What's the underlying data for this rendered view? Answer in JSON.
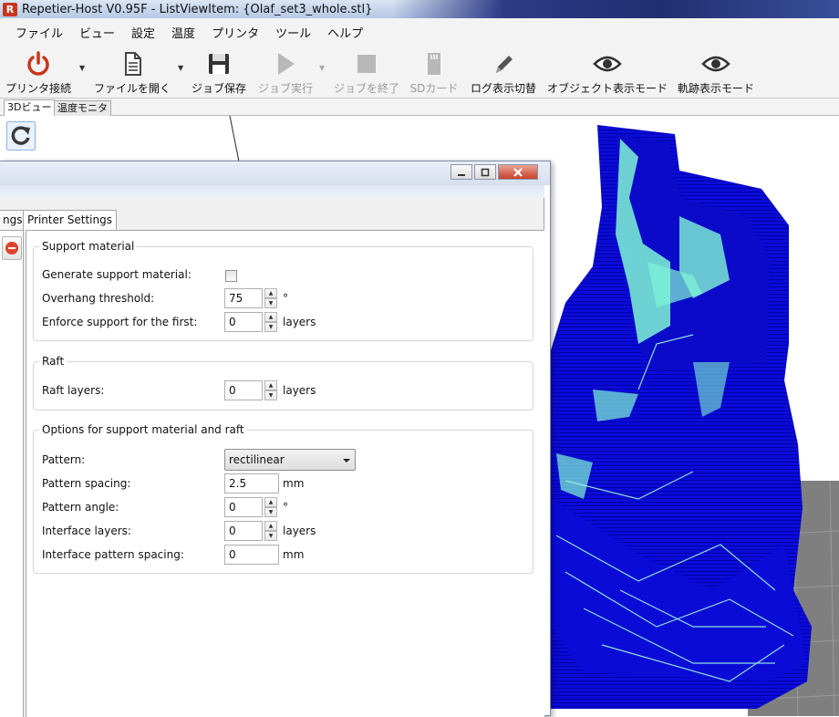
{
  "window": {
    "app_icon_letter": "R",
    "title": "Repetier-Host V0.95F - ListViewItem: {Olaf_set3_whole.stl}"
  },
  "menu": [
    "ファイル",
    "ビュー",
    "設定",
    "温度",
    "プリンタ",
    "ツール",
    "ヘルプ"
  ],
  "toolbar": {
    "connect": "プリンタ接続",
    "open_file": "ファイルを開く",
    "save_job": "ジョブ保存",
    "run_job": "ジョブ実行",
    "end_job": "ジョブを終了",
    "sd_card": "SDカード",
    "log_toggle": "ログ表示切替",
    "object_mode": "オブジェクト表示モード",
    "path_mode": "軌跡表示モード"
  },
  "main_tabs": [
    "3Dビュー",
    "温度モニタ"
  ],
  "settings": {
    "tabs": {
      "partial": "ngs",
      "printer": "Printer Settings"
    },
    "support": {
      "title": "Support material",
      "generate_label": "Generate support material:",
      "generate_checked": false,
      "overhang_label": "Overhang threshold:",
      "overhang_value": "75",
      "overhang_unit": "°",
      "enforce_label": "Enforce support for the first:",
      "enforce_value": "0",
      "enforce_unit": "layers"
    },
    "raft": {
      "title": "Raft",
      "layers_label": "Raft layers:",
      "layers_value": "0",
      "layers_unit": "layers"
    },
    "options": {
      "title": "Options for support material and raft",
      "pattern_label": "Pattern:",
      "pattern_value": "rectilinear",
      "spacing_label": "Pattern spacing:",
      "spacing_value": "2.5",
      "spacing_unit": "mm",
      "angle_label": "Pattern angle:",
      "angle_value": "0",
      "angle_unit": "°",
      "interface_layers_label": "Interface layers:",
      "interface_layers_value": "0",
      "interface_layers_unit": "layers",
      "interface_spacing_label": "Interface pattern spacing:",
      "interface_spacing_value": "0",
      "interface_spacing_unit": "mm"
    }
  },
  "colors": {
    "model_blue": "#0b0bd8",
    "model_cyan": "#7ff5d6",
    "grid_gray": "#7f7f7f"
  }
}
